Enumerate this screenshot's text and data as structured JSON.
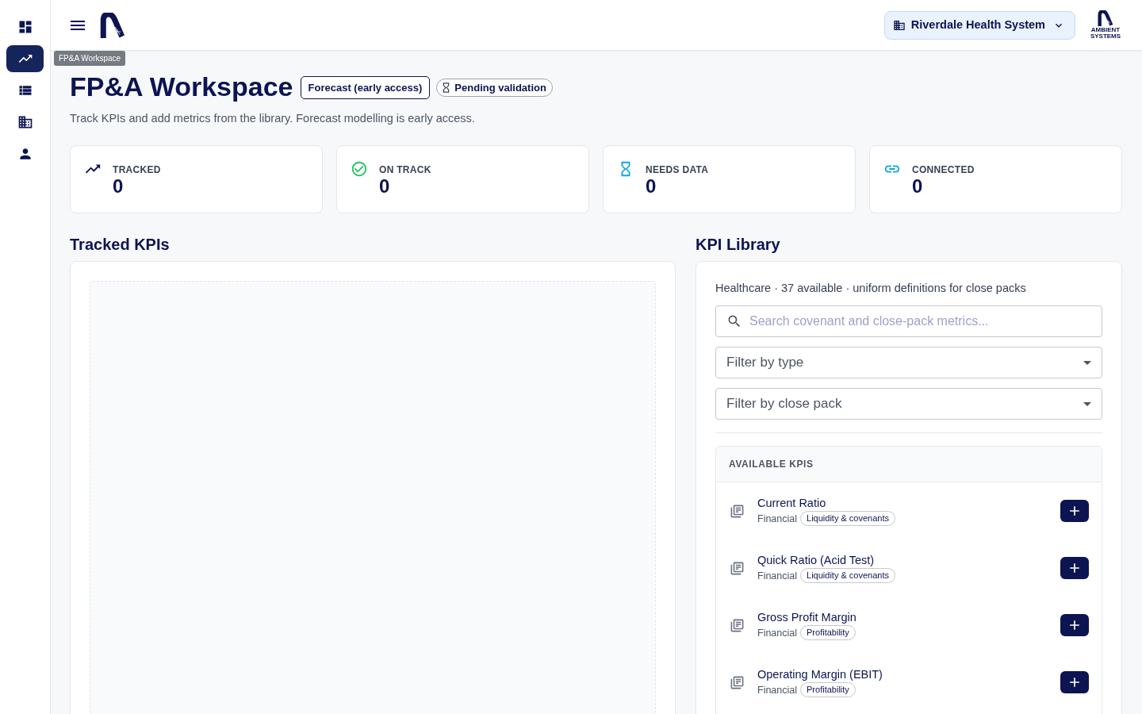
{
  "sidebar": {
    "items": [
      {
        "selected": false
      },
      {
        "selected": true
      },
      {
        "selected": false
      },
      {
        "selected": false
      },
      {
        "selected": false
      }
    ],
    "tooltip": "FP&A Workspace"
  },
  "header": {
    "org_selector": {
      "label": "Riverdale Health System"
    },
    "brand_tagline": "AMBIENT SYSTEMS"
  },
  "page": {
    "title": "FP&A Workspace",
    "badges": [
      {
        "kind": "outlined",
        "label": "Forecast (early access)"
      },
      {
        "kind": "status",
        "label": "Pending validation"
      }
    ],
    "subtitle": "Track KPIs and add metrics from the library. Forecast modelling is early access."
  },
  "stats": [
    {
      "label": "TRACKED",
      "value": "0"
    },
    {
      "label": "ON TRACK",
      "value": "0"
    },
    {
      "label": "NEEDS DATA",
      "value": "0"
    },
    {
      "label": "CONNECTED",
      "value": "0"
    }
  ],
  "tracked_kpis": {
    "title": "Tracked KPIs"
  },
  "kpi_library": {
    "title": "KPI Library",
    "summary": "Healthcare · 37 available · uniform definitions for close packs",
    "search": {
      "placeholder": "Search covenant and close-pack metrics..."
    },
    "filters": [
      {
        "placeholder": "Filter by type"
      },
      {
        "placeholder": "Filter by close pack"
      }
    ],
    "list_heading": "AVAILABLE KPIS",
    "items": [
      {
        "name": "Current Ratio",
        "type": "Financial",
        "tag": "Liquidity & covenants"
      },
      {
        "name": "Quick Ratio (Acid Test)",
        "type": "Financial",
        "tag": "Liquidity & covenants"
      },
      {
        "name": "Gross Profit Margin",
        "type": "Financial",
        "tag": "Profitability"
      },
      {
        "name": "Operating Margin (EBIT)",
        "type": "Financial",
        "tag": "Profitability"
      }
    ]
  }
}
